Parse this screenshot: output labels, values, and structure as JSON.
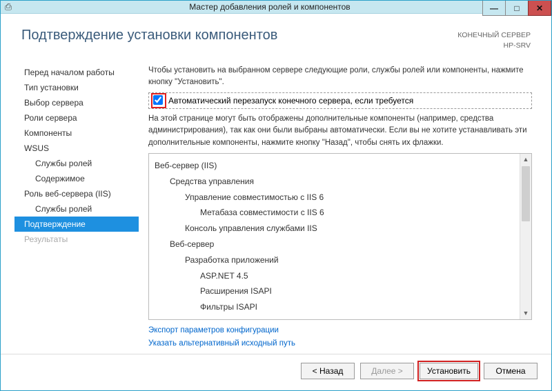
{
  "window": {
    "title": "Мастер добавления ролей и компонентов"
  },
  "header": {
    "title": "Подтверждение установки компонентов",
    "server_label": "КОНЕЧНЫЙ СЕРВЕР",
    "server_name": "HP-SRV"
  },
  "sidebar": {
    "items": [
      {
        "label": "Перед началом работы",
        "sub": false
      },
      {
        "label": "Тип установки",
        "sub": false
      },
      {
        "label": "Выбор сервера",
        "sub": false
      },
      {
        "label": "Роли сервера",
        "sub": false
      },
      {
        "label": "Компоненты",
        "sub": false
      },
      {
        "label": "WSUS",
        "sub": false
      },
      {
        "label": "Службы ролей",
        "sub": true
      },
      {
        "label": "Содержимое",
        "sub": true
      },
      {
        "label": "Роль веб-сервера (IIS)",
        "sub": false
      },
      {
        "label": "Службы ролей",
        "sub": true
      },
      {
        "label": "Подтверждение",
        "sub": false,
        "active": true
      },
      {
        "label": "Результаты",
        "sub": false,
        "disabled": true
      }
    ]
  },
  "content": {
    "intro": "Чтобы установить на выбранном сервере следующие роли, службы ролей или компоненты, нажмите кнопку \"Установить\".",
    "restart_label": "Автоматический перезапуск конечного сервера, если требуется",
    "restart_checked": true,
    "note": "На этой странице могут быть отображены дополнительные компоненты (например, средства администрирования), так как они были выбраны автоматически. Если вы не хотите устанавливать эти дополнительные компоненты, нажмите кнопку \"Назад\", чтобы снять их флажки.",
    "tree": [
      {
        "label": "Веб-сервер (IIS)",
        "level": 0
      },
      {
        "label": "Средства управления",
        "level": 1
      },
      {
        "label": "Управление совместимостью с IIS 6",
        "level": 2
      },
      {
        "label": "Метабаза совместимости с IIS 6",
        "level": 3
      },
      {
        "label": "Консоль управления службами IIS",
        "level": 2
      },
      {
        "label": "Веб-сервер",
        "level": 1
      },
      {
        "label": "Разработка приложений",
        "level": 2
      },
      {
        "label": "ASP.NET 4.5",
        "level": 3
      },
      {
        "label": "Расширения ISAPI",
        "level": 3
      },
      {
        "label": "Фильтры ISAPI",
        "level": 3
      }
    ],
    "links": {
      "export": "Экспорт параметров конфигурации",
      "altsource": "Указать альтернативный исходный путь"
    }
  },
  "buttons": {
    "back": "< Назад",
    "next": "Далее >",
    "install": "Установить",
    "cancel": "Отмена"
  }
}
